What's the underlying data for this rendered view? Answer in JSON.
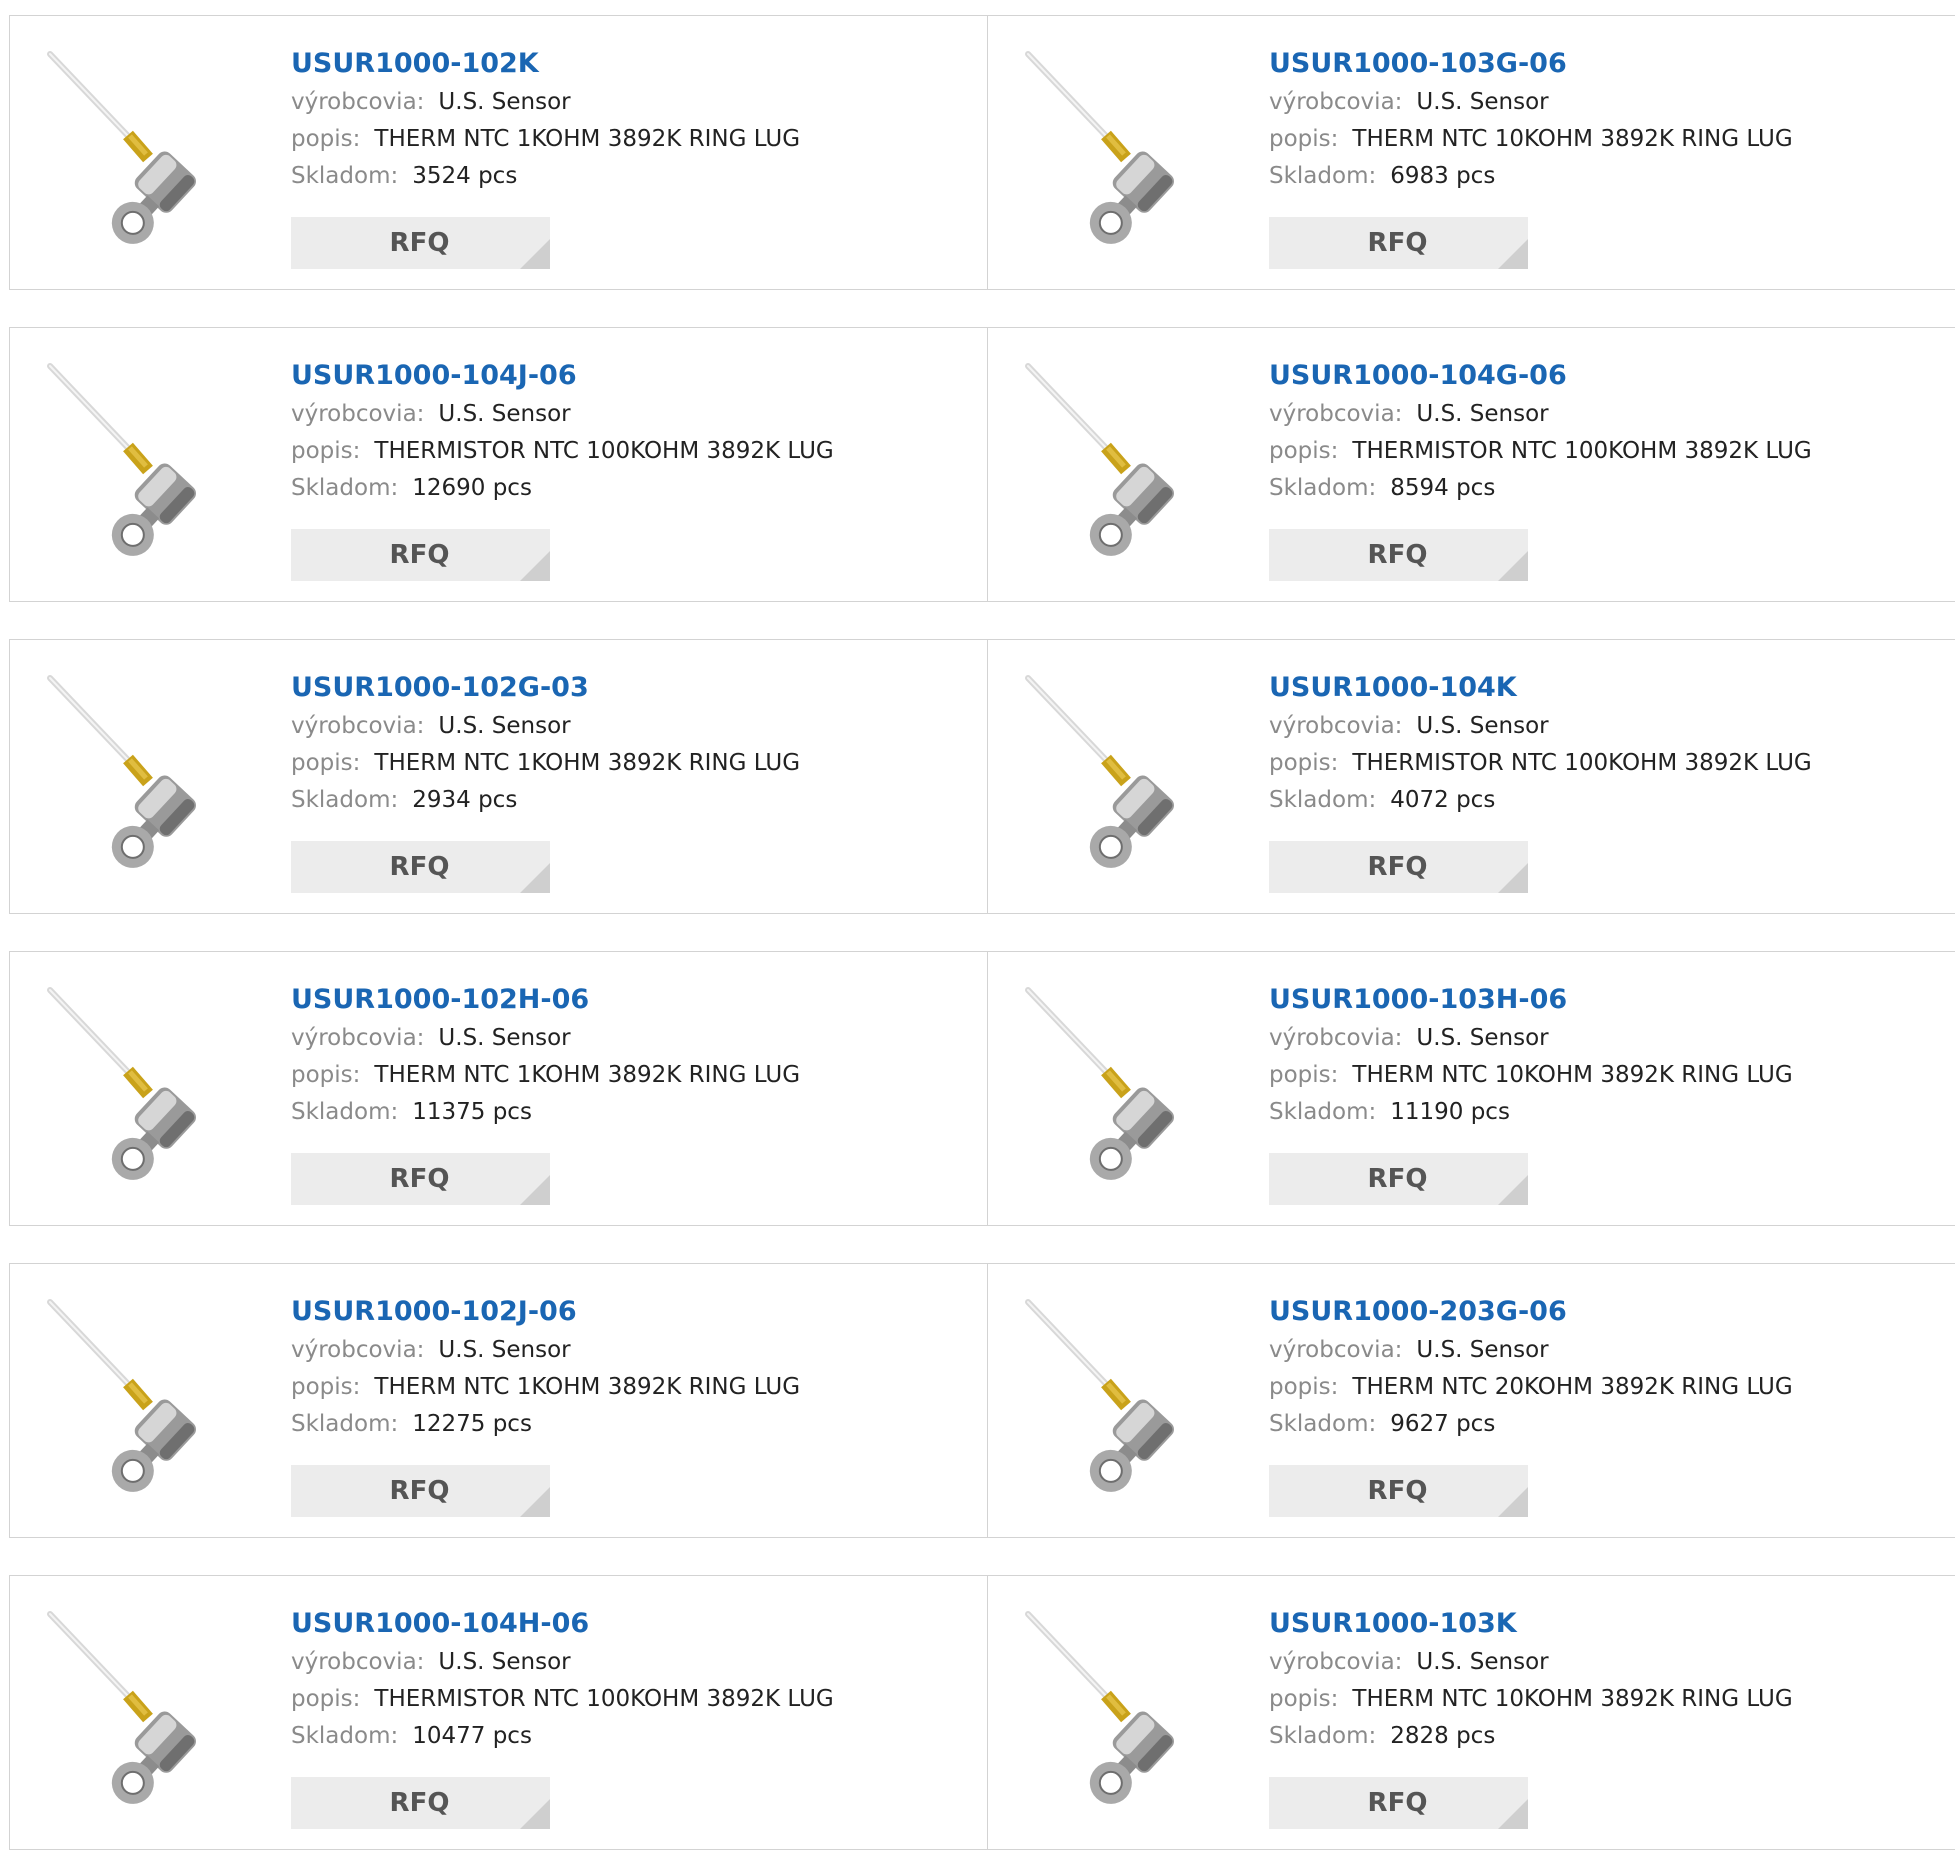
{
  "labels": {
    "manufacturer": "výrobcovia:",
    "description": "popis:",
    "stock": "Skladom:",
    "rfq": "RFQ"
  },
  "products": [
    {
      "part": "USUR1000-102K",
      "manufacturer": "U.S. Sensor",
      "description": "THERM NTC 1KOHM 3892K RING LUG",
      "stock": "3524 pcs"
    },
    {
      "part": "USUR1000-103G-06",
      "manufacturer": "U.S. Sensor",
      "description": "THERM NTC 10KOHM 3892K RING LUG",
      "stock": "6983 pcs"
    },
    {
      "part": "USUR1000-104J-06",
      "manufacturer": "U.S. Sensor",
      "description": "THERMISTOR NTC 100KOHM 3892K LUG",
      "stock": "12690 pcs"
    },
    {
      "part": "USUR1000-104G-06",
      "manufacturer": "U.S. Sensor",
      "description": "THERMISTOR NTC 100KOHM 3892K LUG",
      "stock": "8594 pcs"
    },
    {
      "part": "USUR1000-102G-03",
      "manufacturer": "U.S. Sensor",
      "description": "THERM NTC 1KOHM 3892K RING LUG",
      "stock": "2934 pcs"
    },
    {
      "part": "USUR1000-104K",
      "manufacturer": "U.S. Sensor",
      "description": "THERMISTOR NTC 100KOHM 3892K LUG",
      "stock": "4072 pcs"
    },
    {
      "part": "USUR1000-102H-06",
      "manufacturer": "U.S. Sensor",
      "description": "THERM NTC 1KOHM 3892K RING LUG",
      "stock": "11375 pcs"
    },
    {
      "part": "USUR1000-103H-06",
      "manufacturer": "U.S. Sensor",
      "description": "THERM NTC 10KOHM 3892K RING LUG",
      "stock": "11190 pcs"
    },
    {
      "part": "USUR1000-102J-06",
      "manufacturer": "U.S. Sensor",
      "description": "THERM NTC 1KOHM 3892K RING LUG",
      "stock": "12275 pcs"
    },
    {
      "part": "USUR1000-203G-06",
      "manufacturer": "U.S. Sensor",
      "description": "THERM NTC 20KOHM 3892K RING LUG",
      "stock": "9627 pcs"
    },
    {
      "part": "USUR1000-104H-06",
      "manufacturer": "U.S. Sensor",
      "description": "THERMISTOR NTC 100KOHM 3892K LUG",
      "stock": "10477 pcs"
    },
    {
      "part": "USUR1000-103K",
      "manufacturer": "U.S. Sensor",
      "description": "THERM NTC 10KOHM 3892K RING LUG",
      "stock": "2828 pcs"
    }
  ],
  "image_icon": "thermistor-ring-lug-product-image",
  "colors": {
    "link": "#1a66b3",
    "label": "#8a8a8a",
    "button_bg": "#ececec"
  }
}
